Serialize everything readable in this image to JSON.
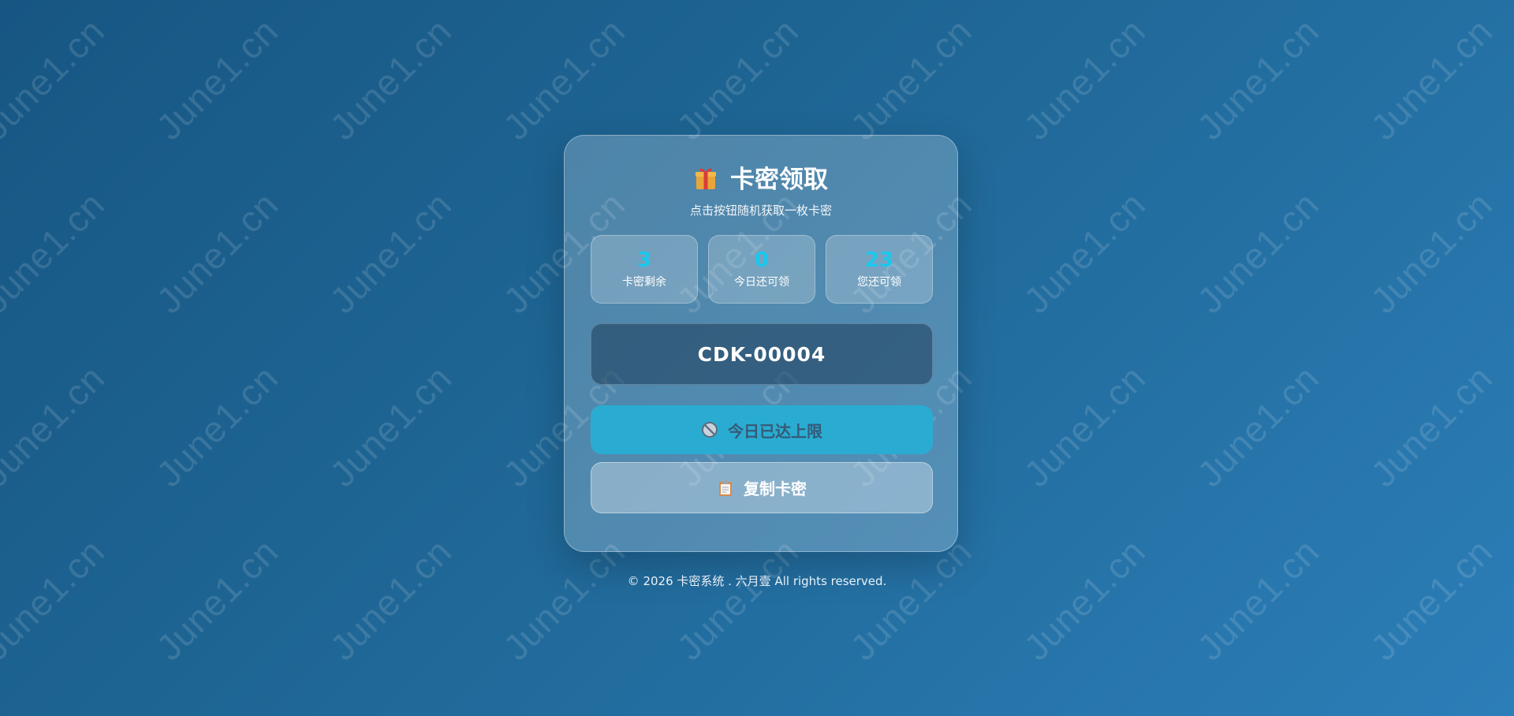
{
  "watermark": {
    "text": "June1.cn"
  },
  "card": {
    "title": "卡密领取",
    "subtitle": "点击按钮随机获取一枚卡密",
    "stats": [
      {
        "value": "3",
        "label": "卡密剩余"
      },
      {
        "value": "0",
        "label": "今日还可领"
      },
      {
        "value": "23",
        "label": "您还可领"
      }
    ],
    "code": "CDK-00004",
    "claim_button": "今日已达上限",
    "copy_button": "复制卡密"
  },
  "footer": {
    "text": "© 2026 卡密系统 . 六月壹 All rights reserved."
  },
  "colors": {
    "accent": "#19c8ee",
    "claim_button_bg": "#2aacd2"
  },
  "icons": {
    "title": "gift-icon",
    "claim": "no-entry-icon",
    "copy": "clipboard-icon"
  }
}
